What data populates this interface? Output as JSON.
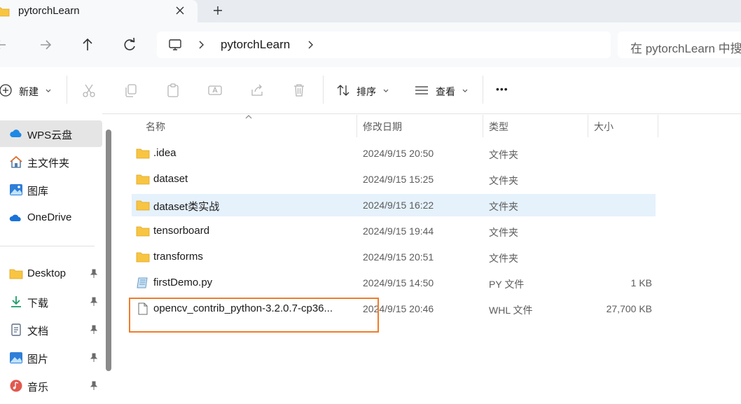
{
  "window": {
    "tab_title": "pytorchLearn",
    "new_tab_symbol": "+"
  },
  "address_bar": {
    "crumbs": [
      "pytorchLearn"
    ],
    "search_placeholder": "在 pytorchLearn 中搜"
  },
  "command_bar": {
    "new_label": "新建",
    "sort_label": "排序",
    "view_label": "查看",
    "more_symbol": "•••"
  },
  "sidebar": {
    "items": [
      {
        "label": "WPS云盘",
        "icon": "cloud-icon",
        "selected": true
      },
      {
        "label": "主文件夹",
        "icon": "home-icon"
      },
      {
        "label": "图库",
        "icon": "gallery-icon"
      },
      {
        "label": "OneDrive",
        "icon": "onedrive-icon"
      }
    ],
    "pinned": [
      {
        "label": "Desktop",
        "icon": "desktop-folder-icon"
      },
      {
        "label": "下载",
        "icon": "download-icon"
      },
      {
        "label": "文档",
        "icon": "documents-icon"
      },
      {
        "label": "图片",
        "icon": "pictures-icon"
      },
      {
        "label": "音乐",
        "icon": "music-icon"
      }
    ]
  },
  "columns": [
    "名称",
    "修改日期",
    "类型",
    "大小"
  ],
  "files": [
    {
      "name": ".idea",
      "date": "2024/9/15 20:50",
      "type": "文件夹",
      "size": "",
      "icon": "folder-icon"
    },
    {
      "name": "dataset",
      "date": "2024/9/15 15:25",
      "type": "文件夹",
      "size": "",
      "icon": "folder-icon"
    },
    {
      "name": "dataset类实战",
      "date": "2024/9/15 16:22",
      "type": "文件夹",
      "size": "",
      "icon": "folder-icon",
      "selected": true
    },
    {
      "name": "tensorboard",
      "date": "2024/9/15 19:44",
      "type": "文件夹",
      "size": "",
      "icon": "folder-icon"
    },
    {
      "name": "transforms",
      "date": "2024/9/15 20:51",
      "type": "文件夹",
      "size": "",
      "icon": "folder-icon"
    },
    {
      "name": "firstDemo.py",
      "date": "2024/9/15 14:50",
      "type": "PY 文件",
      "size": "1 KB",
      "icon": "python-file-icon"
    },
    {
      "name": "opencv_contrib_python-3.2.0.7-cp36...",
      "date": "2024/9/15 20:46",
      "type": "WHL 文件",
      "size": "27,700 KB",
      "icon": "generic-file-icon"
    }
  ],
  "colors": {
    "highlight_border": "#f07c2a",
    "selection": "#e5f1fb",
    "folder": "#f8c542",
    "accent": "#0067c0"
  }
}
